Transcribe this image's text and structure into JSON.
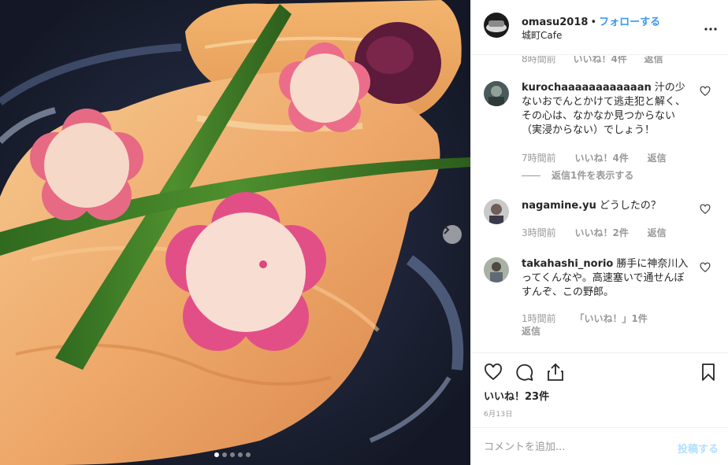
{
  "header": {
    "username": "omasu2018",
    "separator": "•",
    "follow_label": "フォローする",
    "location": "城町Cafe",
    "more_icon": "more-horizontal-icon"
  },
  "comments": {
    "partial_meta": {
      "time": "8時間前",
      "likes": "いいね！4件",
      "reply": "返信"
    },
    "items": [
      {
        "username": "kurochaaaaaaaaaaaan",
        "text": "汁の少ないおでんとかけて逃走犯と解く、その心は、なかなか見つからない（実浸からない）でしょう！",
        "time": "7時間前",
        "likes": "いいね！4件",
        "reply": "返信",
        "view_replies": "返信1件を表示する"
      },
      {
        "username": "nagamine.yu",
        "text": "どうしたの？",
        "time": "3時間前",
        "likes": "いいね！2件",
        "reply": "返信"
      },
      {
        "username": "takahashi_norio",
        "text": "勝手に神奈川入ってくんなや。高速塞いで通せんぼすんぞ、この野郎。",
        "time": "1時間前",
        "likes": "「いいね！」1件",
        "reply": "返信"
      }
    ]
  },
  "actions": {
    "likes": "いいね！23件",
    "date": "6月13日",
    "comment_placeholder": "コメントを追加...",
    "post_label": "投稿する"
  },
  "carousel": {
    "slides": 5,
    "active": 1
  }
}
